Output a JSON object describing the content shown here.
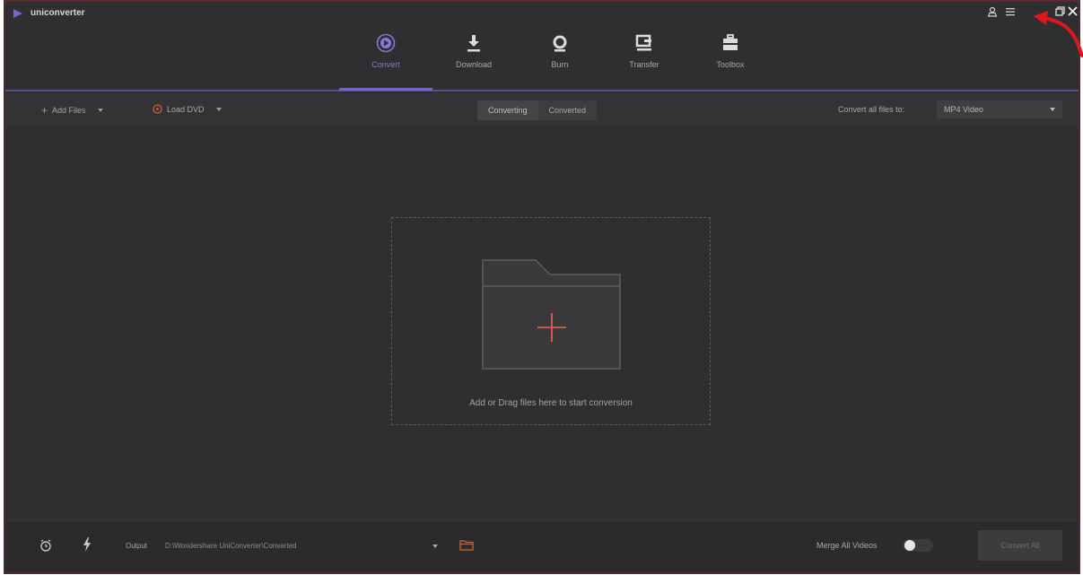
{
  "app": {
    "title": "uniconverter"
  },
  "nav": {
    "items": [
      {
        "label": "Convert",
        "icon": "convert-icon",
        "active": true
      },
      {
        "label": "Download",
        "icon": "download-icon",
        "active": false
      },
      {
        "label": "Burn",
        "icon": "burn-icon",
        "active": false
      },
      {
        "label": "Transfer",
        "icon": "transfer-icon",
        "active": false
      },
      {
        "label": "Toolbox",
        "icon": "toolbox-icon",
        "active": false
      }
    ]
  },
  "toolbar": {
    "add_files": "Add Files",
    "load_dvd": "Load DVD",
    "tabs": [
      {
        "label": "Converting",
        "active": true
      },
      {
        "label": "Converted",
        "active": false
      }
    ],
    "convert_all_label": "Convert all files to:",
    "format_value": "MP4 Video"
  },
  "dropzone": {
    "text": "Add or Drag files here to start conversion"
  },
  "bottom": {
    "output_label": "Output",
    "output_path": "D:\\Wondershare UniConverter\\Converted",
    "merge_label": "Merge All Videos",
    "merge_enabled": false,
    "convert_all_button": "Convert All"
  },
  "colors": {
    "accent": "#7e61d0",
    "background": "#2f2f31",
    "annotation": "#e0161c"
  }
}
